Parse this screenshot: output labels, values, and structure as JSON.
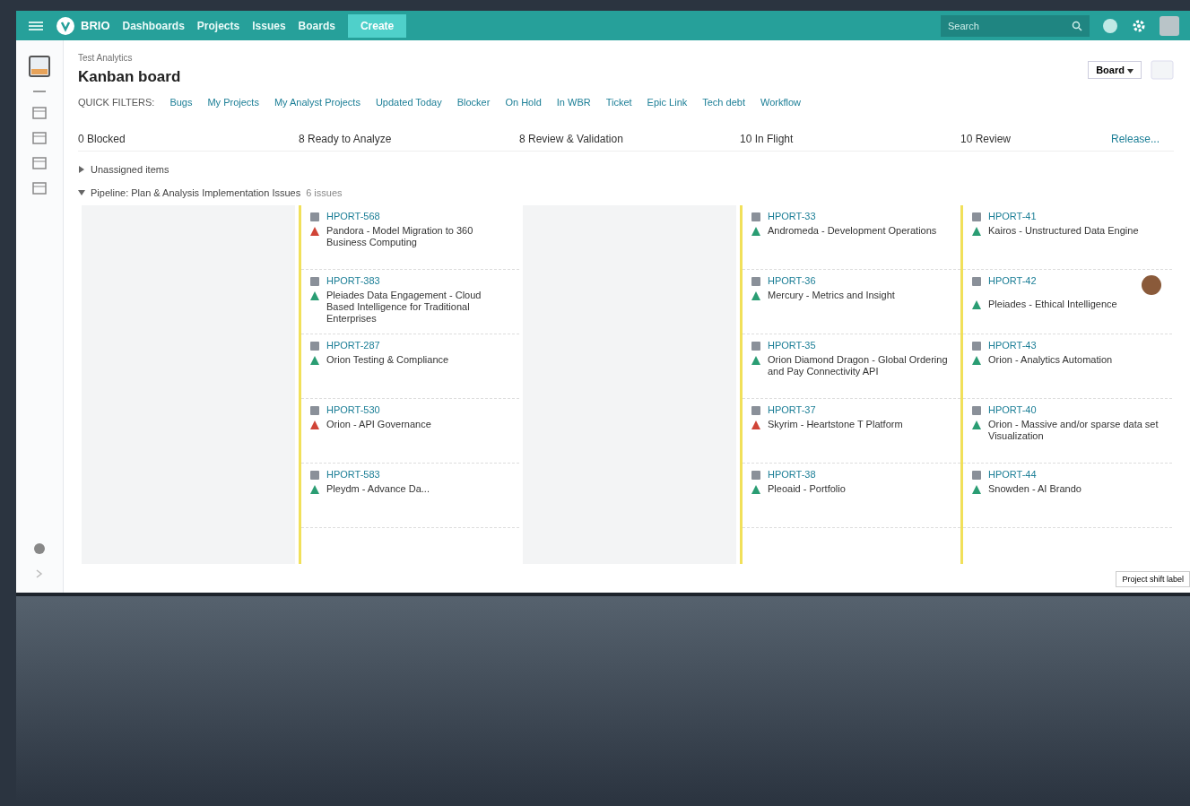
{
  "nav": {
    "logo": "BRIO",
    "items": [
      {
        "label": "Dashboards"
      },
      {
        "label": "Projects"
      },
      {
        "label": "Issues"
      },
      {
        "label": "Boards"
      }
    ],
    "create": "Create",
    "search": {
      "placeholder": "Search"
    }
  },
  "header": {
    "breadcrumb": "Test Analytics",
    "title": "Kanban board",
    "board_button": "Board",
    "quick_filters_label": "QUICK FILTERS:",
    "filters": [
      {
        "label": "Bugs",
        "selected": false
      },
      {
        "label": "My Projects",
        "selected": false
      },
      {
        "label": "My Analyst Projects",
        "selected": false
      },
      {
        "label": "Updated Today",
        "selected": false
      },
      {
        "label": "Blocker",
        "selected": false
      },
      {
        "label": "On Hold",
        "selected": false
      },
      {
        "label": "In WBR",
        "selected": false
      },
      {
        "label": "Ticket",
        "selected": false
      },
      {
        "label": "Epic Link",
        "selected": false
      },
      {
        "label": "Tech debt",
        "selected": false
      },
      {
        "label": "Workflow",
        "selected": false
      }
    ]
  },
  "columns": [
    {
      "title": "0 Blocked"
    },
    {
      "title": "8 Ready to Analyze"
    },
    {
      "title": "8 Review & Validation"
    },
    {
      "title": "10 In Flight"
    },
    {
      "title": "10 Review"
    }
  ],
  "release": "Release...",
  "swimlanes": [
    {
      "title": "Unassigned items",
      "expanded": false
    },
    {
      "title": "Pipeline: Plan & Analysis Implementation Issues",
      "extra": "6 issues",
      "expanded": true,
      "cells": [
        [],
        [
          {
            "key": "HPORT-568",
            "summary": "Pandora - Model Migration to 360 Business Computing",
            "color": "#d04437"
          },
          {
            "key": "HPORT-383",
            "summary": "Pleiades Data Engagement - Cloud Based Intelligence for Traditional Enterprises",
            "color": "#2a9d73"
          },
          {
            "key": "HPORT-287",
            "summary": "Orion Testing & Compliance",
            "color": "#2a9d73"
          },
          {
            "key": "HPORT-530",
            "summary": "Orion - API Governance",
            "color": "#d04437"
          },
          {
            "key": "HPORT-583",
            "summary": "Pleydm - Advance Da...",
            "color": "#2a9d73"
          }
        ],
        [],
        [
          {
            "key": "HPORT-33",
            "summary": "Andromeda - Development Operations",
            "color": "#2a9d73"
          },
          {
            "key": "HPORT-36",
            "summary": "Mercury - Metrics and Insight",
            "color": "#2a9d73"
          },
          {
            "key": "HPORT-35",
            "summary": "Orion Diamond Dragon - Global Ordering and Pay Connectivity API",
            "color": "#2a9d73"
          },
          {
            "key": "HPORT-37",
            "summary": "Skyrim - Heartstone T Platform",
            "color": "#d04437"
          },
          {
            "key": "HPORT-38",
            "summary": "Pleoaid - Portfolio",
            "color": "#2a9d73"
          }
        ],
        [
          {
            "key": "HPORT-41",
            "summary": "Kairos - Unstructured Data Engine",
            "color": "#2a9d73"
          },
          {
            "key": "HPORT-42",
            "summary": "Pleiades - Ethical Intelligence",
            "color": "#2a9d73",
            "avatar": true
          },
          {
            "key": "HPORT-43",
            "summary": "Orion - Analytics Automation",
            "color": "#2a9d73"
          },
          {
            "key": "HPORT-40",
            "summary": "Orion - Massive and/or sparse data set Visualization",
            "color": "#2a9d73"
          },
          {
            "key": "HPORT-44",
            "summary": "Snowden - AI Brando",
            "color": "#2a9d73"
          }
        ]
      ]
    }
  ],
  "tooltip": "Project shift label"
}
